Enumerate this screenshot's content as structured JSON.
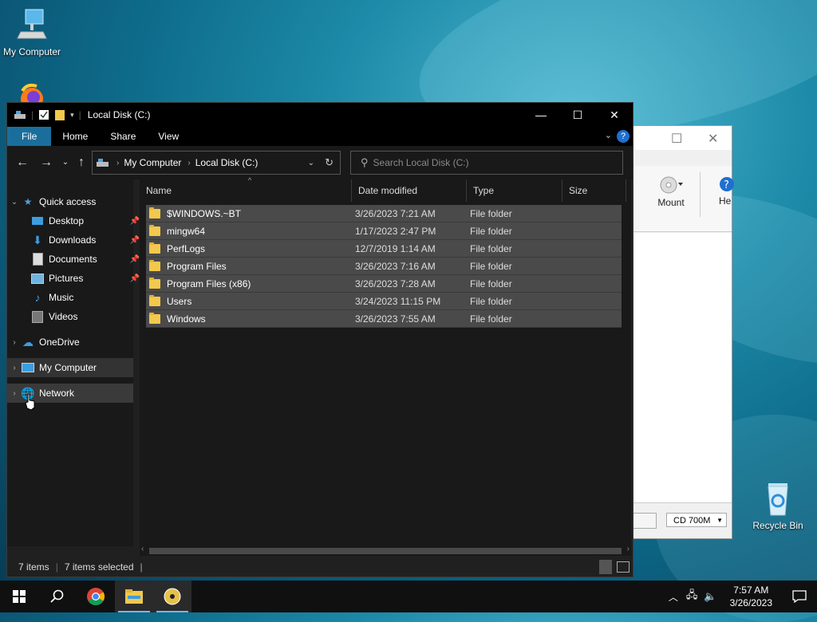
{
  "desktop": {
    "icons": [
      {
        "label": "My Computer"
      },
      {
        "label": "Recycle Bin"
      }
    ]
  },
  "bg_window": {
    "mount_label": "Mount",
    "help_label": "He",
    "cd_select": "CD 700M"
  },
  "explorer": {
    "title": "Local Disk (C:)",
    "tabs": [
      "File",
      "Home",
      "Share",
      "View"
    ],
    "breadcrumb": [
      "My Computer",
      "Local Disk (C:)"
    ],
    "search_placeholder": "Search Local Disk (C:)",
    "nav": [
      {
        "label": "Quick access",
        "icon": "star-icon"
      },
      {
        "label": "Desktop",
        "icon": "desktop-icon",
        "pinned": true
      },
      {
        "label": "Downloads",
        "icon": "download-icon",
        "pinned": true
      },
      {
        "label": "Documents",
        "icon": "document-icon",
        "pinned": true
      },
      {
        "label": "Pictures",
        "icon": "pictures-icon",
        "pinned": true
      },
      {
        "label": "Music",
        "icon": "music-icon"
      },
      {
        "label": "Videos",
        "icon": "videos-icon"
      },
      {
        "label": "OneDrive",
        "icon": "cloud-icon"
      },
      {
        "label": "My Computer",
        "icon": "computer-icon"
      },
      {
        "label": "Network",
        "icon": "network-icon"
      }
    ],
    "columns": [
      "Name",
      "Date modified",
      "Type",
      "Size"
    ],
    "rows": [
      {
        "name": "$WINDOWS.~BT",
        "date": "3/26/2023 7:21 AM",
        "type": "File folder"
      },
      {
        "name": "mingw64",
        "date": "1/17/2023 2:47 PM",
        "type": "File folder"
      },
      {
        "name": "PerfLogs",
        "date": "12/7/2019 1:14 AM",
        "type": "File folder"
      },
      {
        "name": "Program Files",
        "date": "3/26/2023 7:16 AM",
        "type": "File folder"
      },
      {
        "name": "Program Files (x86)",
        "date": "3/26/2023 7:28 AM",
        "type": "File folder"
      },
      {
        "name": "Users",
        "date": "3/24/2023 11:15 PM",
        "type": "File folder"
      },
      {
        "name": "Windows",
        "date": "3/26/2023 7:55 AM",
        "type": "File folder"
      }
    ],
    "status": {
      "count": "7 items",
      "selected": "7 items selected"
    }
  },
  "taskbar": {
    "time": "7:57 AM",
    "date": "3/26/2023"
  },
  "colors": {
    "accent": "#1a6e9c",
    "folder": "#f2c94c",
    "selection": "#4a4a4a"
  }
}
